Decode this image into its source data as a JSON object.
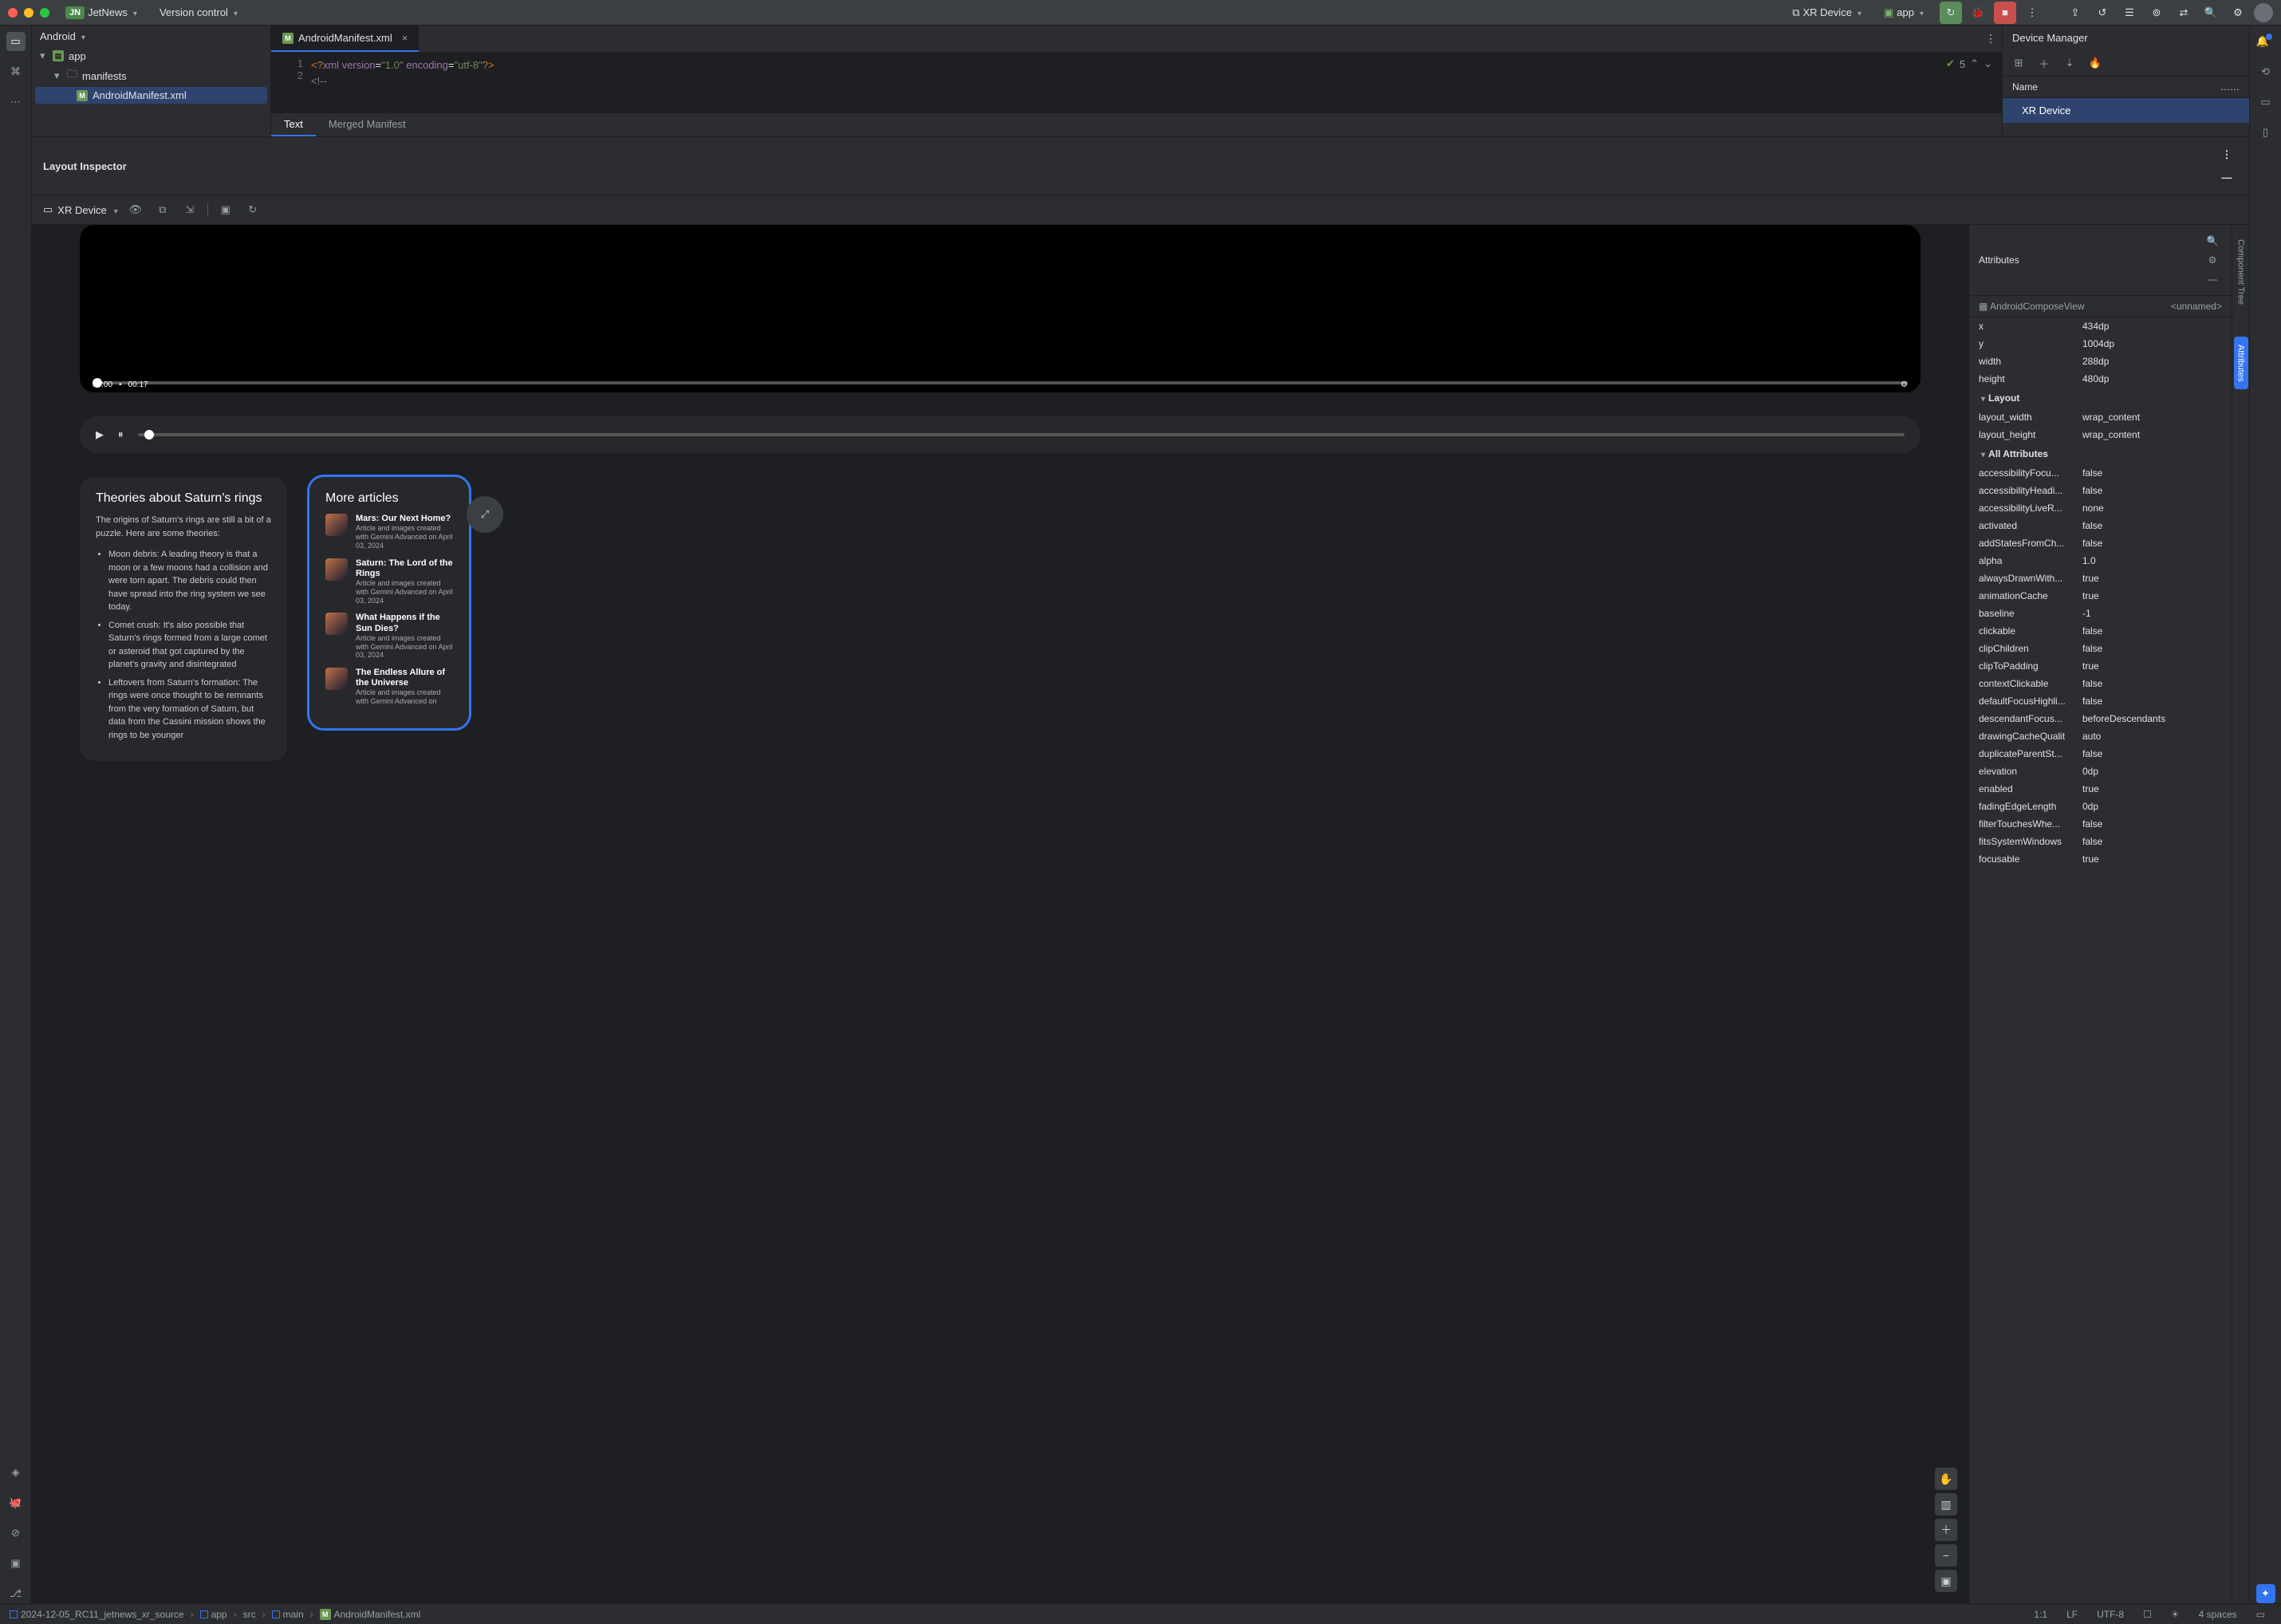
{
  "titlebar": {
    "project_badge": "JN",
    "project_name": "JetNews",
    "vcs": "Version control",
    "run_target": "XR Device",
    "run_config": "app"
  },
  "project_panel": {
    "title": "Android",
    "tree": {
      "app": "app",
      "manifests": "manifests",
      "file": "AndroidManifest.xml"
    }
  },
  "editor": {
    "tab": "AndroidManifest.xml",
    "line1": "<?xml version=\"1.0\" encoding=\"utf-8\"?>",
    "line2": "<!--",
    "status_count": "5",
    "bottom_tab_text": "Text",
    "bottom_tab_merged": "Merged Manifest"
  },
  "device_manager": {
    "title": "Device Manager",
    "col_name": "Name",
    "row1": "XR Device"
  },
  "layout_inspector": {
    "title": "Layout Inspector",
    "device": "XR Device",
    "video": {
      "cur": "00:00",
      "dur": "00:17"
    },
    "card1": {
      "title": "Theories about Saturn's rings",
      "intro": "The origins of Saturn's rings are still a bit of a puzzle. Here are some theories:",
      "b1": "Moon debris: A leading theory is that a moon or a few moons had a collision and were torn apart. The debris could then have spread into the ring system we see today.",
      "b2": "Comet crush: It's also possible that Saturn's rings formed from a large comet or asteroid that got captured by the planet's gravity and disintegrated",
      "b3": "Leftovers from Saturn's formation: The rings were once thought to be remnants from the very formation of Saturn, but data from the Cassini mission shows the rings to be younger"
    },
    "card2": {
      "title": "More articles",
      "items": [
        {
          "title": "Mars: Our Next Home?",
          "sub": "Article and images created with Gemini Advanced on April 03, 2024"
        },
        {
          "title": "Saturn: The Lord of the Rings",
          "sub": "Article and images created with Gemini Advanced on April 03, 2024"
        },
        {
          "title": "What Happens if the Sun Dies?",
          "sub": "Article and images created with Gemini Advanced on April 03, 2024"
        },
        {
          "title": "The Endless Allure of the Universe",
          "sub": "Article and images created with Gemini Advanced on"
        }
      ]
    }
  },
  "attributes": {
    "header": "Attributes",
    "component": "AndroidComposeView",
    "component_id": "<unnamed>",
    "basic": [
      {
        "k": "x",
        "v": "434dp"
      },
      {
        "k": "y",
        "v": "1004dp"
      },
      {
        "k": "width",
        "v": "288dp"
      },
      {
        "k": "height",
        "v": "480dp"
      }
    ],
    "layout_section": "Layout",
    "layout": [
      {
        "k": "layout_width",
        "v": "wrap_content"
      },
      {
        "k": "layout_height",
        "v": "wrap_content"
      }
    ],
    "all_section": "All Attributes",
    "all": [
      {
        "k": "accessibilityFocu...",
        "v": "false"
      },
      {
        "k": "accessibilityHeadi...",
        "v": "false"
      },
      {
        "k": "accessibilityLiveR...",
        "v": "none"
      },
      {
        "k": "activated",
        "v": "false"
      },
      {
        "k": "addStatesFromCh...",
        "v": "false"
      },
      {
        "k": "alpha",
        "v": "1.0"
      },
      {
        "k": "alwaysDrawnWith...",
        "v": "true"
      },
      {
        "k": "animationCache",
        "v": "true"
      },
      {
        "k": "baseline",
        "v": "-1"
      },
      {
        "k": "clickable",
        "v": "false"
      },
      {
        "k": "clipChildren",
        "v": "false"
      },
      {
        "k": "clipToPadding",
        "v": "true"
      },
      {
        "k": "contextClickable",
        "v": "false"
      },
      {
        "k": "defaultFocusHighli...",
        "v": "false"
      },
      {
        "k": "descendantFocus...",
        "v": "beforeDescendants"
      },
      {
        "k": "drawingCacheQualit",
        "v": "auto"
      },
      {
        "k": "duplicateParentSt...",
        "v": "false"
      },
      {
        "k": "elevation",
        "v": "0dp"
      },
      {
        "k": "enabled",
        "v": "true"
      },
      {
        "k": "fadingEdgeLength",
        "v": "0dp"
      },
      {
        "k": "filterTouchesWhe...",
        "v": "false"
      },
      {
        "k": "fitsSystemWindows",
        "v": "false"
      },
      {
        "k": "focusable",
        "v": "true"
      }
    ]
  },
  "side_tabs": {
    "component_tree": "Component Tree",
    "attributes": "Attributes"
  },
  "statusbar": {
    "crumbs": [
      "2024-12-05_RC11_jetnews_xr_source",
      "app",
      "src",
      "main",
      "AndroidManifest.xml"
    ],
    "pos": "1:1",
    "le": "LF",
    "enc": "UTF-8",
    "indent": "4 spaces"
  }
}
